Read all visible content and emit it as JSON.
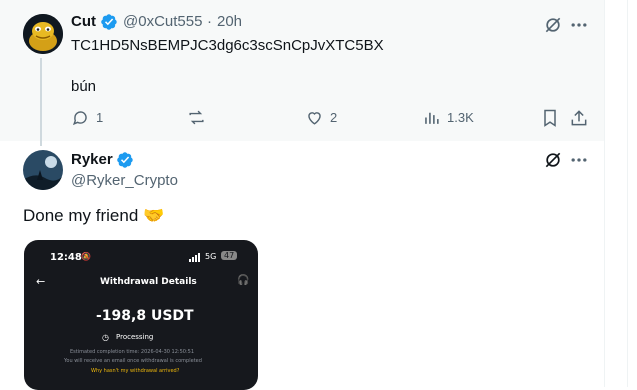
{
  "tweet1": {
    "name": "Cut",
    "handle": "@0xCut555",
    "separator": "·",
    "time": "20h",
    "address": "TC1HD5NsBEMPJC3dg6c3scSnCpJvXTC5BX",
    "message": "bún",
    "replies": "1",
    "likes": "2",
    "views": "1.3K"
  },
  "tweet2": {
    "name": "Ryker",
    "handle": "@Ryker_Crypto",
    "text": "Done my friend",
    "emoji": "🤝"
  },
  "screenshot": {
    "clock": "12:48",
    "network": "5G",
    "battery": "47",
    "title": "Withdrawal Details",
    "amount": "-198,8 USDT",
    "status": "Processing",
    "est_time": "Estimated completion time: 2026-04-30 12:50:51",
    "notice": "You will receive an email once withdrawal is completed",
    "help_link": "Why hasn't my withdrawal arrived?"
  },
  "colors": {
    "verified": "#1d9bf0",
    "accent_yellow": "#f0b90b",
    "muted": "#536471"
  }
}
